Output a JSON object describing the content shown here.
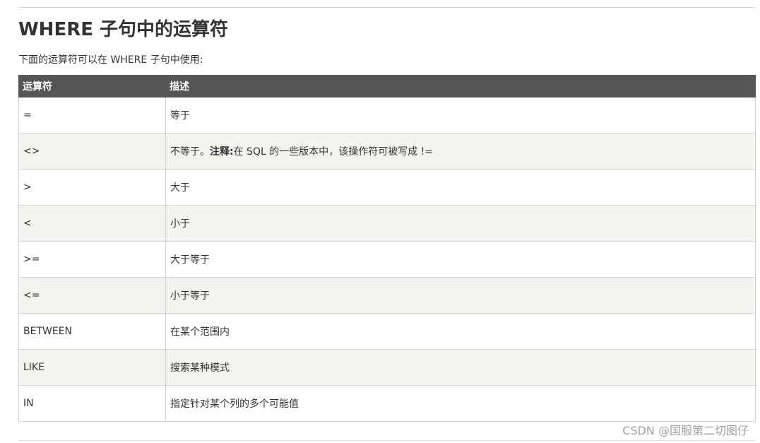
{
  "title": "WHERE 子句中的运算符",
  "intro": "下面的运算符可以在 WHERE 子句中使用:",
  "table": {
    "headers": [
      "运算符",
      "描述"
    ],
    "rows": [
      {
        "op": "=",
        "desc": "等于"
      },
      {
        "op": "<>",
        "desc_pre": "不等于。",
        "desc_note": "注释:",
        "desc_post": "在 SQL 的一些版本中，该操作符可被写成 !="
      },
      {
        "op": ">",
        "desc": "大于"
      },
      {
        "op": "<",
        "desc": "小于"
      },
      {
        "op": ">=",
        "desc": "大于等于"
      },
      {
        "op": "<=",
        "desc": "小于等于"
      },
      {
        "op": "BETWEEN",
        "desc": "在某个范围内"
      },
      {
        "op": "LIKE",
        "desc": "搜索某种模式"
      },
      {
        "op": "IN",
        "desc": "指定针对某个列的多个可能值"
      }
    ]
  },
  "watermark": "CSDN @国服第二切图仔"
}
